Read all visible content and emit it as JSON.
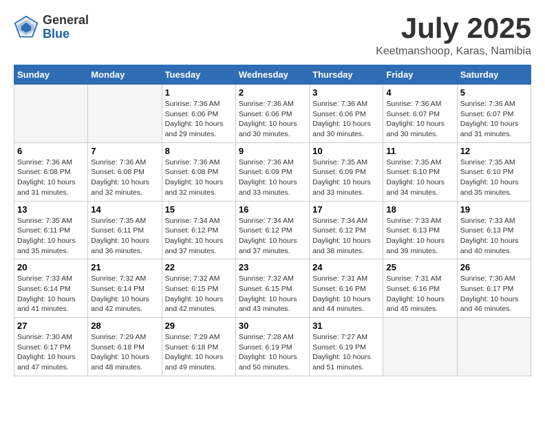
{
  "header": {
    "logo_general": "General",
    "logo_blue": "Blue",
    "title": "July 2025",
    "subtitle": "Keetmanshoop, Karas, Namibia"
  },
  "weekdays": [
    "Sunday",
    "Monday",
    "Tuesday",
    "Wednesday",
    "Thursday",
    "Friday",
    "Saturday"
  ],
  "weeks": [
    [
      {
        "day": "",
        "empty": true
      },
      {
        "day": "",
        "empty": true
      },
      {
        "day": "1",
        "sunrise": "Sunrise: 7:36 AM",
        "sunset": "Sunset: 6:06 PM",
        "daylight": "Daylight: 10 hours and 29 minutes."
      },
      {
        "day": "2",
        "sunrise": "Sunrise: 7:36 AM",
        "sunset": "Sunset: 6:06 PM",
        "daylight": "Daylight: 10 hours and 30 minutes."
      },
      {
        "day": "3",
        "sunrise": "Sunrise: 7:36 AM",
        "sunset": "Sunset: 6:06 PM",
        "daylight": "Daylight: 10 hours and 30 minutes."
      },
      {
        "day": "4",
        "sunrise": "Sunrise: 7:36 AM",
        "sunset": "Sunset: 6:07 PM",
        "daylight": "Daylight: 10 hours and 30 minutes."
      },
      {
        "day": "5",
        "sunrise": "Sunrise: 7:36 AM",
        "sunset": "Sunset: 6:07 PM",
        "daylight": "Daylight: 10 hours and 31 minutes."
      }
    ],
    [
      {
        "day": "6",
        "sunrise": "Sunrise: 7:36 AM",
        "sunset": "Sunset: 6:08 PM",
        "daylight": "Daylight: 10 hours and 31 minutes."
      },
      {
        "day": "7",
        "sunrise": "Sunrise: 7:36 AM",
        "sunset": "Sunset: 6:08 PM",
        "daylight": "Daylight: 10 hours and 32 minutes."
      },
      {
        "day": "8",
        "sunrise": "Sunrise: 7:36 AM",
        "sunset": "Sunset: 6:08 PM",
        "daylight": "Daylight: 10 hours and 32 minutes."
      },
      {
        "day": "9",
        "sunrise": "Sunrise: 7:36 AM",
        "sunset": "Sunset: 6:09 PM",
        "daylight": "Daylight: 10 hours and 33 minutes."
      },
      {
        "day": "10",
        "sunrise": "Sunrise: 7:35 AM",
        "sunset": "Sunset: 6:09 PM",
        "daylight": "Daylight: 10 hours and 33 minutes."
      },
      {
        "day": "11",
        "sunrise": "Sunrise: 7:35 AM",
        "sunset": "Sunset: 6:10 PM",
        "daylight": "Daylight: 10 hours and 34 minutes."
      },
      {
        "day": "12",
        "sunrise": "Sunrise: 7:35 AM",
        "sunset": "Sunset: 6:10 PM",
        "daylight": "Daylight: 10 hours and 35 minutes."
      }
    ],
    [
      {
        "day": "13",
        "sunrise": "Sunrise: 7:35 AM",
        "sunset": "Sunset: 6:11 PM",
        "daylight": "Daylight: 10 hours and 35 minutes."
      },
      {
        "day": "14",
        "sunrise": "Sunrise: 7:35 AM",
        "sunset": "Sunset: 6:11 PM",
        "daylight": "Daylight: 10 hours and 36 minutes."
      },
      {
        "day": "15",
        "sunrise": "Sunrise: 7:34 AM",
        "sunset": "Sunset: 6:12 PM",
        "daylight": "Daylight: 10 hours and 37 minutes."
      },
      {
        "day": "16",
        "sunrise": "Sunrise: 7:34 AM",
        "sunset": "Sunset: 6:12 PM",
        "daylight": "Daylight: 10 hours and 37 minutes."
      },
      {
        "day": "17",
        "sunrise": "Sunrise: 7:34 AM",
        "sunset": "Sunset: 6:12 PM",
        "daylight": "Daylight: 10 hours and 38 minutes."
      },
      {
        "day": "18",
        "sunrise": "Sunrise: 7:33 AM",
        "sunset": "Sunset: 6:13 PM",
        "daylight": "Daylight: 10 hours and 39 minutes."
      },
      {
        "day": "19",
        "sunrise": "Sunrise: 7:33 AM",
        "sunset": "Sunset: 6:13 PM",
        "daylight": "Daylight: 10 hours and 40 minutes."
      }
    ],
    [
      {
        "day": "20",
        "sunrise": "Sunrise: 7:33 AM",
        "sunset": "Sunset: 6:14 PM",
        "daylight": "Daylight: 10 hours and 41 minutes."
      },
      {
        "day": "21",
        "sunrise": "Sunrise: 7:32 AM",
        "sunset": "Sunset: 6:14 PM",
        "daylight": "Daylight: 10 hours and 42 minutes."
      },
      {
        "day": "22",
        "sunrise": "Sunrise: 7:32 AM",
        "sunset": "Sunset: 6:15 PM",
        "daylight": "Daylight: 10 hours and 42 minutes."
      },
      {
        "day": "23",
        "sunrise": "Sunrise: 7:32 AM",
        "sunset": "Sunset: 6:15 PM",
        "daylight": "Daylight: 10 hours and 43 minutes."
      },
      {
        "day": "24",
        "sunrise": "Sunrise: 7:31 AM",
        "sunset": "Sunset: 6:16 PM",
        "daylight": "Daylight: 10 hours and 44 minutes."
      },
      {
        "day": "25",
        "sunrise": "Sunrise: 7:31 AM",
        "sunset": "Sunset: 6:16 PM",
        "daylight": "Daylight: 10 hours and 45 minutes."
      },
      {
        "day": "26",
        "sunrise": "Sunrise: 7:30 AM",
        "sunset": "Sunset: 6:17 PM",
        "daylight": "Daylight: 10 hours and 46 minutes."
      }
    ],
    [
      {
        "day": "27",
        "sunrise": "Sunrise: 7:30 AM",
        "sunset": "Sunset: 6:17 PM",
        "daylight": "Daylight: 10 hours and 47 minutes."
      },
      {
        "day": "28",
        "sunrise": "Sunrise: 7:29 AM",
        "sunset": "Sunset: 6:18 PM",
        "daylight": "Daylight: 10 hours and 48 minutes."
      },
      {
        "day": "29",
        "sunrise": "Sunrise: 7:29 AM",
        "sunset": "Sunset: 6:18 PM",
        "daylight": "Daylight: 10 hours and 49 minutes."
      },
      {
        "day": "30",
        "sunrise": "Sunrise: 7:28 AM",
        "sunset": "Sunset: 6:19 PM",
        "daylight": "Daylight: 10 hours and 50 minutes."
      },
      {
        "day": "31",
        "sunrise": "Sunrise: 7:27 AM",
        "sunset": "Sunset: 6:19 PM",
        "daylight": "Daylight: 10 hours and 51 minutes."
      },
      {
        "day": "",
        "empty": true
      },
      {
        "day": "",
        "empty": true
      }
    ]
  ]
}
